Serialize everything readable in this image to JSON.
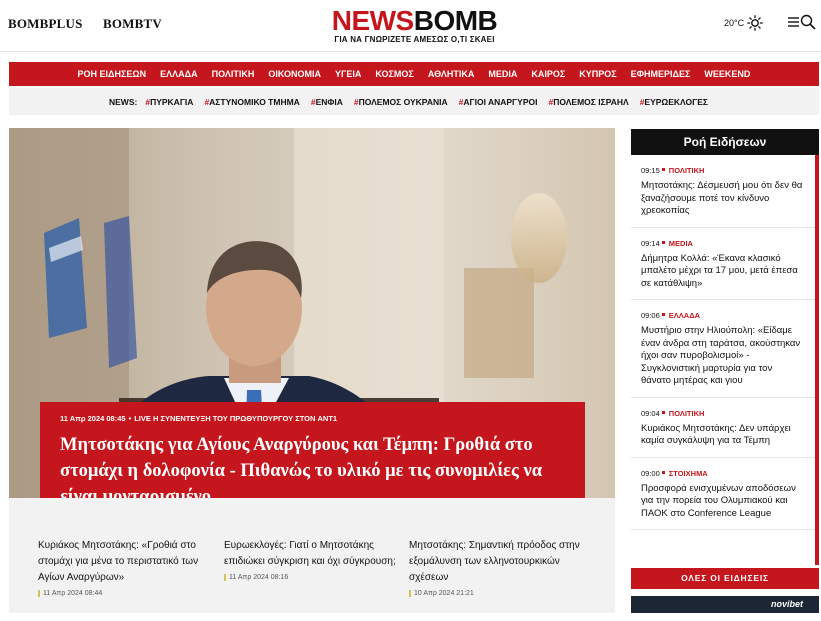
{
  "header": {
    "brand_plus": "BOMBPLUS",
    "brand_tv": "BOMBTV",
    "logo_news": "NEWS",
    "logo_bomb": "BOMB",
    "tagline": "ΓΙΑ ΝΑ ΓΝΩΡΙΖΕΤΕ ΑΜΕΣΩΣ Ο,ΤΙ ΣΚΑΕΙ",
    "temperature": "20°C",
    "weather_icon": "sun-icon",
    "menu_icon": "hamburger-icon",
    "search_icon": "search-icon"
  },
  "nav": {
    "items": [
      "ΡΟΗ ΕΙΔΗΣΕΩΝ",
      "ΕΛΛΑΔΑ",
      "ΠΟΛΙΤΙΚΗ",
      "ΟΙΚΟΝΟΜΙΑ",
      "ΥΓΕΙΑ",
      "ΚΟΣΜΟΣ",
      "ΑΘΛΗΤΙΚΑ",
      "MEDIA",
      "ΚΑΙΡΟΣ",
      "ΚΥΠΡΟΣ",
      "ΕΦΗΜΕΡΙΔΕΣ",
      "WEEKEND"
    ]
  },
  "tags": {
    "label": "NEWS:",
    "items": [
      "ΠΥΡΚΑΓΙΑ",
      "ΑΣΤΥΝΟΜΙΚΟ ΤΜΗΜΑ",
      "ΕΝΦΙΑ",
      "ΠΟΛΕΜΟΣ ΟΥΚΡΑΝΙΑ",
      "ΑΓΙΟΙ ΑΝΑΡΓΥΡΟΙ",
      "ΠΟΛΕΜΟΣ ΙΣΡΑΗΛ",
      "ΕΥΡΩΕΚΛΟΓΕΣ"
    ]
  },
  "hero": {
    "date": "11 Απρ 2024 08:45",
    "label": "LIVE Η ΣΥΝΕΝΤΕΥΞΗ ΤΟΥ ΠΡΩΘΥΠΟΥΡΓΟΥ ΣΤΟΝ ANT1",
    "title": "Μητσοτάκης για Αγίους Αναργύρους και Τέμπη: Γροθιά στο στομάχι η δολοφονία - Πιθανώς το υλικό με τις συνομιλίες να είναι μονταρισμένο"
  },
  "sub_articles": [
    {
      "title": "Κυριάκος Μητσοτάκης: «Γροθιά στο στομάχι για μένα το περιστατικό των Αγίων Αναργύρων»",
      "date": "11 Απρ 2024 08:44"
    },
    {
      "title": "Ευρωεκλογές: Γιατί ο Μητσοτάκης επιδιώκει σύγκριση και όχι σύγκρουση;",
      "date": "11 Απρ 2024 08:16"
    },
    {
      "title": "Μητσοτάκης: Σημαντική πρόοδος στην εξομάλυνση των ελληνοτουρκικών σχέσεων",
      "date": "10 Απρ 2024 21:21"
    }
  ],
  "feed": {
    "heading": "Ροή Ειδήσεων",
    "items": [
      {
        "time": "09:15",
        "category": "ΠΟΛΙΤΙΚΗ",
        "title": "Μητσοτάκης: Δέσμευσή μου ότι δεν θα ξαναζήσουμε ποτέ τον κίνδυνο χρεοκοπίας"
      },
      {
        "time": "09:14",
        "category": "MEDIA",
        "title": "Δήμητρα Κολλά: «Έκανα κλασικό μπαλέτο μέχρι τα 17 μου, μετά έπεσα σε κατάθλιψη»"
      },
      {
        "time": "09:06",
        "category": "ΕΛΛΑΔΑ",
        "title": "Μυστήριο στην Ηλιούπολη: «Είδαμε έναν άνδρα στη ταράτσα, ακούστηκαν ήχοι σαν πυροβολισμοί» - Συγκλονιστική μαρτυρία για τον θάνατο μητέρας και γιου"
      },
      {
        "time": "09:04",
        "category": "ΠΟΛΙΤΙΚΗ",
        "title": "Κυριάκος Μητσοτάκης: Δεν υπάρχει καμία συγκάλυψη για τα Τέμπη"
      },
      {
        "time": "09:00",
        "category": "ΣΤΟΙΧΗΜΑ",
        "title": "Προσφορά ενισχυμένων αποδόσεων για την πορεία του Ολυμπιακού και ΠΑΟΚ στο Conference League"
      }
    ],
    "all_news": "ΟΛΕΣ ΟΙ ΕΙΔΗΣΕΙΣ"
  },
  "ad": {
    "label": "novibet"
  },
  "colors": {
    "brand_red": "#c4161c",
    "dark": "#111111",
    "light_bg": "#f2f2f2"
  }
}
